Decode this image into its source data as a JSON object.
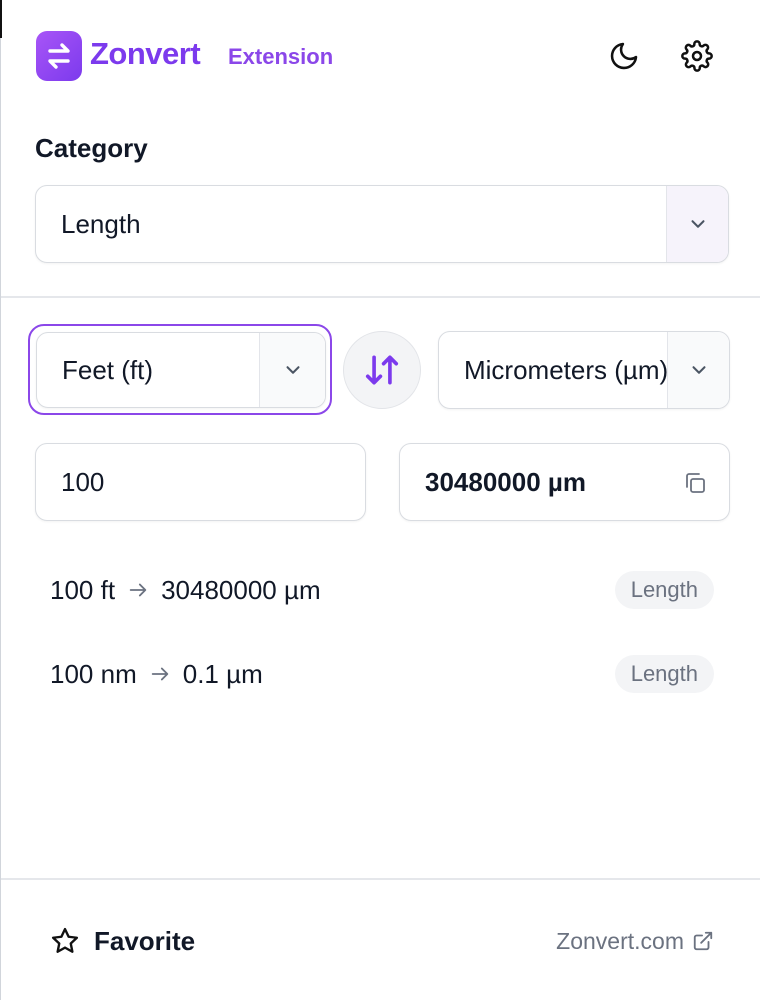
{
  "header": {
    "brand": "Zonvert",
    "brand_sub": "Extension",
    "logo_icon": "swap-arrows-icon",
    "theme_icon": "moon-icon",
    "settings_icon": "gear-icon"
  },
  "category": {
    "label": "Category",
    "selected": "Length"
  },
  "converter": {
    "from_unit": "Feet (ft)",
    "to_unit": "Micrometers (µm)",
    "input_value": "100",
    "output_value": "30480000 µm",
    "swap_icon": "swap-vertical-icon",
    "copy_icon": "copy-icon"
  },
  "history": [
    {
      "from": "100 ft",
      "to": "30480000 µm",
      "badge": "Length"
    },
    {
      "from": "100 nm",
      "to": "0.1 µm",
      "badge": "Length"
    }
  ],
  "footer": {
    "favorite_label": "Favorite",
    "favorite_icon": "star-icon",
    "site_link": "Zonvert.com",
    "external_icon": "external-link-icon"
  },
  "colors": {
    "accent": "#7c3aed",
    "accent_light": "#8b47e9",
    "muted_text": "#6b7280",
    "border": "#d9dce1"
  }
}
